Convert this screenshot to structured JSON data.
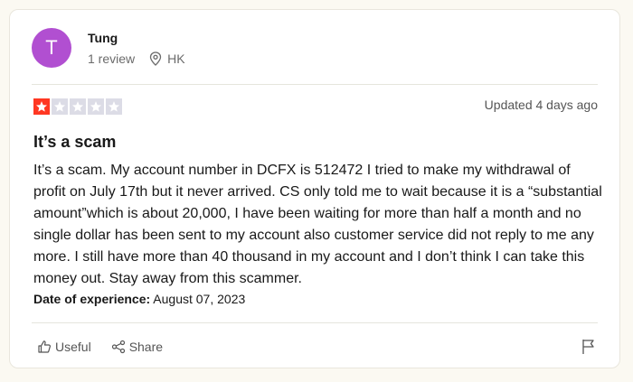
{
  "colors": {
    "page_bg": "#fbf9f2",
    "avatar_bg": "#b14fd1",
    "star_on": "#ff3722",
    "star_off": "#dcdce6"
  },
  "user": {
    "initial": "T",
    "name": "Tung",
    "reviews": "1 review",
    "location": "HK"
  },
  "review": {
    "rating": 1,
    "rating_max": 5,
    "updated": "Updated 4 days ago",
    "title": "It’s a scam",
    "body": "It’s a scam. My account number in DCFX is 512472 I tried to make my withdrawal of profit on July 17th but it never arrived. CS only told me to wait because it is a “substantial amount”which is about 20,000, I have been waiting for more than half a month and no single dollar has been sent to my account also customer service did not reply to me any more. I still have more than 40 thousand in my account and I don’t think I can take this money out. Stay away from this scammer.",
    "date_label": "Date of experience:",
    "date_value": "August 07, 2023"
  },
  "actions": {
    "useful": "Useful",
    "share": "Share"
  },
  "icons": {
    "location": "location-pin-icon",
    "useful": "thumbs-up-icon",
    "share": "share-icon",
    "report": "flag-icon",
    "star": "star-icon"
  }
}
